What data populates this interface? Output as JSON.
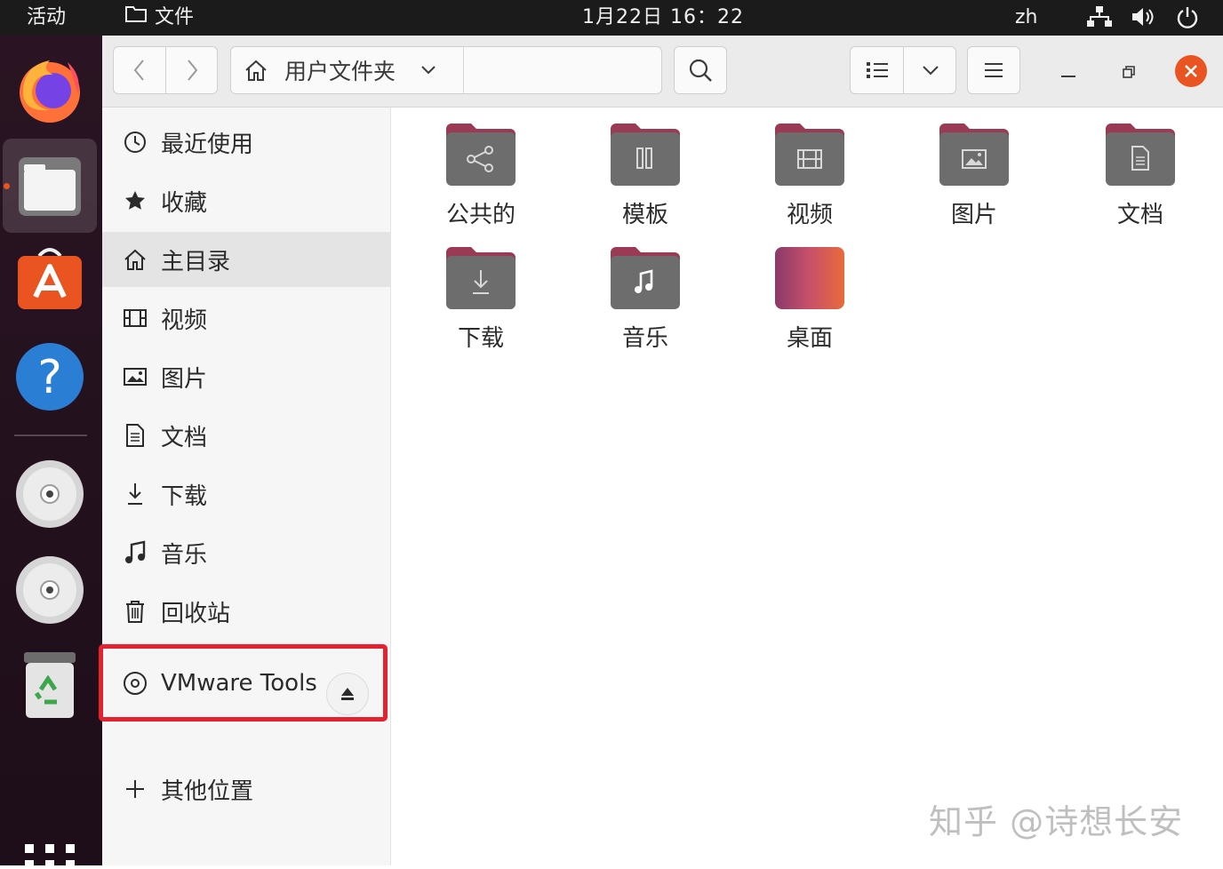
{
  "topbar": {
    "activities": "活动",
    "app_name": "文件",
    "clock": "1月22日  16：22",
    "lang": "zh"
  },
  "window": {
    "path_label": "用户文件夹"
  },
  "sidebar": {
    "items": [
      {
        "label": "最近使用"
      },
      {
        "label": "收藏"
      },
      {
        "label": "主目录"
      },
      {
        "label": "视频"
      },
      {
        "label": "图片"
      },
      {
        "label": "文档"
      },
      {
        "label": "下载"
      },
      {
        "label": "音乐"
      },
      {
        "label": "回收站"
      }
    ],
    "device": {
      "label": "VMware Tools"
    },
    "other": {
      "label": "其他位置"
    }
  },
  "content": {
    "folders": [
      {
        "label": "公共的",
        "icon": "share-icon"
      },
      {
        "label": "模板",
        "icon": "template-icon"
      },
      {
        "label": "视频",
        "icon": "film-icon"
      },
      {
        "label": "图片",
        "icon": "image-icon"
      },
      {
        "label": "文档",
        "icon": "document-icon"
      },
      {
        "label": "下载",
        "icon": "download-icon"
      },
      {
        "label": "音乐",
        "icon": "music-icon"
      },
      {
        "label": "桌面",
        "icon": "desktop-folder-icon"
      }
    ]
  },
  "colors": {
    "accent": "#e95420",
    "folder_dark": "#6d6d6d",
    "folder_tab": "#9a3a55",
    "highlight_border": "#e52330"
  },
  "watermark": "知乎 @诗想长安"
}
